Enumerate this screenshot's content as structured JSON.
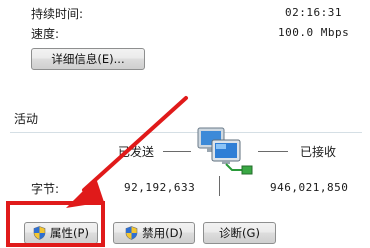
{
  "connection": {
    "duration_label": "持续时间:",
    "duration_value": "02:16:31",
    "speed_label": "速度:",
    "speed_value": "100.0 Mbps",
    "details_button": "详细信息(E)..."
  },
  "activity": {
    "group_title": "活动",
    "sent_label": "已发送",
    "received_label": "已接收",
    "bytes_label": "字节:",
    "bytes_sent": "92,192,633",
    "bytes_received": "946,021,850"
  },
  "buttons": {
    "properties": "属性(P)",
    "disable": "禁用(D)",
    "diagnose": "诊断(G)"
  },
  "icons": {
    "network": "network-computers-icon",
    "shield": "uac-shield-icon",
    "arrow": "red-pointer-arrow"
  },
  "colors": {
    "annotation_red": "#e01a1a",
    "group_line": "#d5dfe5"
  }
}
